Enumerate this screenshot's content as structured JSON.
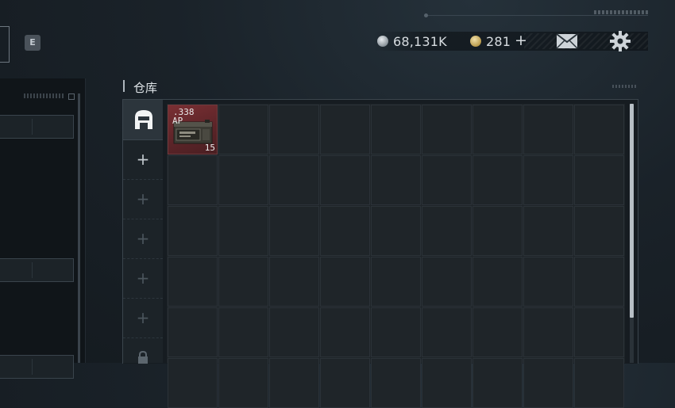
{
  "hotkey": {
    "label": "E"
  },
  "currency": {
    "silver_icon": "silver-coin-icon",
    "silver_amount": "68,131K",
    "gold_icon": "gold-coin-icon",
    "gold_amount": "281",
    "gold_add": "+"
  },
  "header_icons": {
    "mail": "mail-icon",
    "settings": "gear-icon"
  },
  "warehouse": {
    "title": "仓库",
    "tabs": [
      {
        "type": "active",
        "icon": "warehouse-icon"
      },
      {
        "type": "add",
        "label": "+"
      },
      {
        "type": "add",
        "label": "+"
      },
      {
        "type": "add",
        "label": "+"
      },
      {
        "type": "add",
        "label": "+"
      },
      {
        "type": "add",
        "label": "+"
      },
      {
        "type": "locked",
        "icon": "lock-icon"
      }
    ],
    "grid": {
      "columns": 9,
      "rows": 6
    },
    "items": [
      {
        "caliber": ".338",
        "type": "AP",
        "quantity": "15",
        "icon": "ammo-crate-icon",
        "rarity_color": "#6b2a2e"
      }
    ]
  }
}
